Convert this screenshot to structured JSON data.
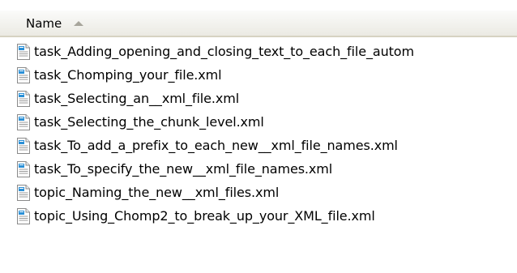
{
  "header": {
    "name_label": "Name",
    "sort_direction": "ascending"
  },
  "files": [
    {
      "name": "task_Adding_opening_and_closing_text_to_each_file_autom",
      "icon": "xml-file-icon"
    },
    {
      "name": "task_Chomping_your_file.xml",
      "icon": "xml-file-icon"
    },
    {
      "name": "task_Selecting_an__xml_file.xml",
      "icon": "xml-file-icon"
    },
    {
      "name": "task_Selecting_the_chunk_level.xml",
      "icon": "xml-file-icon"
    },
    {
      "name": "task_To_add_a_prefix_to_each_new__xml_file_names.xml",
      "icon": "xml-file-icon"
    },
    {
      "name": "task_To_specify_the_new__xml_file_names.xml",
      "icon": "xml-file-icon"
    },
    {
      "name": "topic_Naming_the_new__xml_files.xml",
      "icon": "xml-file-icon"
    },
    {
      "name": "topic_Using_Chomp2_to_break_up_your_XML_file.xml",
      "icon": "xml-file-icon"
    }
  ],
  "colors": {
    "header_border": "#d6d2c2",
    "sort_arrow": "#a7a59b",
    "icon_accent": "#2a8fd6"
  }
}
